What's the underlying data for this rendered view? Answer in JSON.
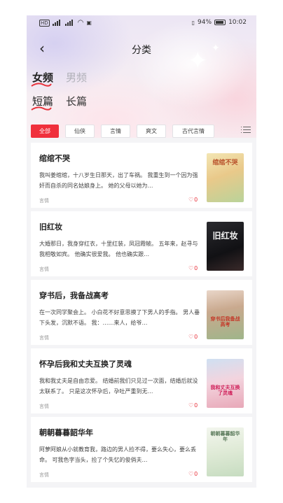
{
  "status_bar": {
    "network_label": "HD",
    "battery_percent": "94%",
    "time": "10:02"
  },
  "header": {
    "title": "分类"
  },
  "gender_tabs": [
    {
      "label": "女频",
      "active": true
    },
    {
      "label": "男频",
      "active": false
    }
  ],
  "length_tabs": [
    {
      "label": "短篇",
      "active": true
    },
    {
      "label": "长篇",
      "active": false
    }
  ],
  "categories": [
    {
      "label": "全部",
      "active": true
    },
    {
      "label": "仙侠",
      "active": false
    },
    {
      "label": "言情",
      "active": false
    },
    {
      "label": "爽文",
      "active": false
    },
    {
      "label": "古代言情",
      "active": false
    }
  ],
  "books": [
    {
      "title": "绾绾不哭",
      "description": "我叫姜绾绾，十八岁生日那天，出了车祸。 我重生到一个因为强奸而自杀的同名姑娘身上。 她的父母以她为…",
      "genre": "言情",
      "likes": "0",
      "cover_text": "绾绾不哭"
    },
    {
      "title": "旧红妆",
      "description": "大婚那日，我身穿红衣，十里红装，凤冠霞帔。 五年来，赵寻与我相敬如宾。 他确实很爱我。 他也确实跟…",
      "genre": "言情",
      "likes": "0",
      "cover_text": "旧红妆"
    },
    {
      "title": "穿书后，我备战高考",
      "description": "在一次同学聚会上。 小白花不好意思摸了下男人的手指。 男人垂下头发，沉默不语。 我：……来人，给爷…",
      "genre": "言情",
      "likes": "0",
      "cover_text": "穿书后我备战高考"
    },
    {
      "title": "怀孕后我和丈夫互换了灵魂",
      "description": "我和我丈夫是自由恋爱。 结婚前我们只见过一次面，结婚后就没太联系了。 只是这次怀孕后，孕吐严重到无…",
      "genre": "言情",
      "likes": "0",
      "cover_text": "我和丈夫互换了灵魂"
    },
    {
      "title": "朝朝暮暮韶华年",
      "description": "阿萝阿娘从小就教育我，路边的男人捡不得，要么失心，要么丢命。 可我色字当头，捡了个失忆的俊俏夫…",
      "genre": "言情",
      "likes": "0",
      "cover_text": "朝朝暮暮韶华年"
    }
  ],
  "colors": {
    "accent": "#f0303c",
    "like": "#e8323c"
  }
}
